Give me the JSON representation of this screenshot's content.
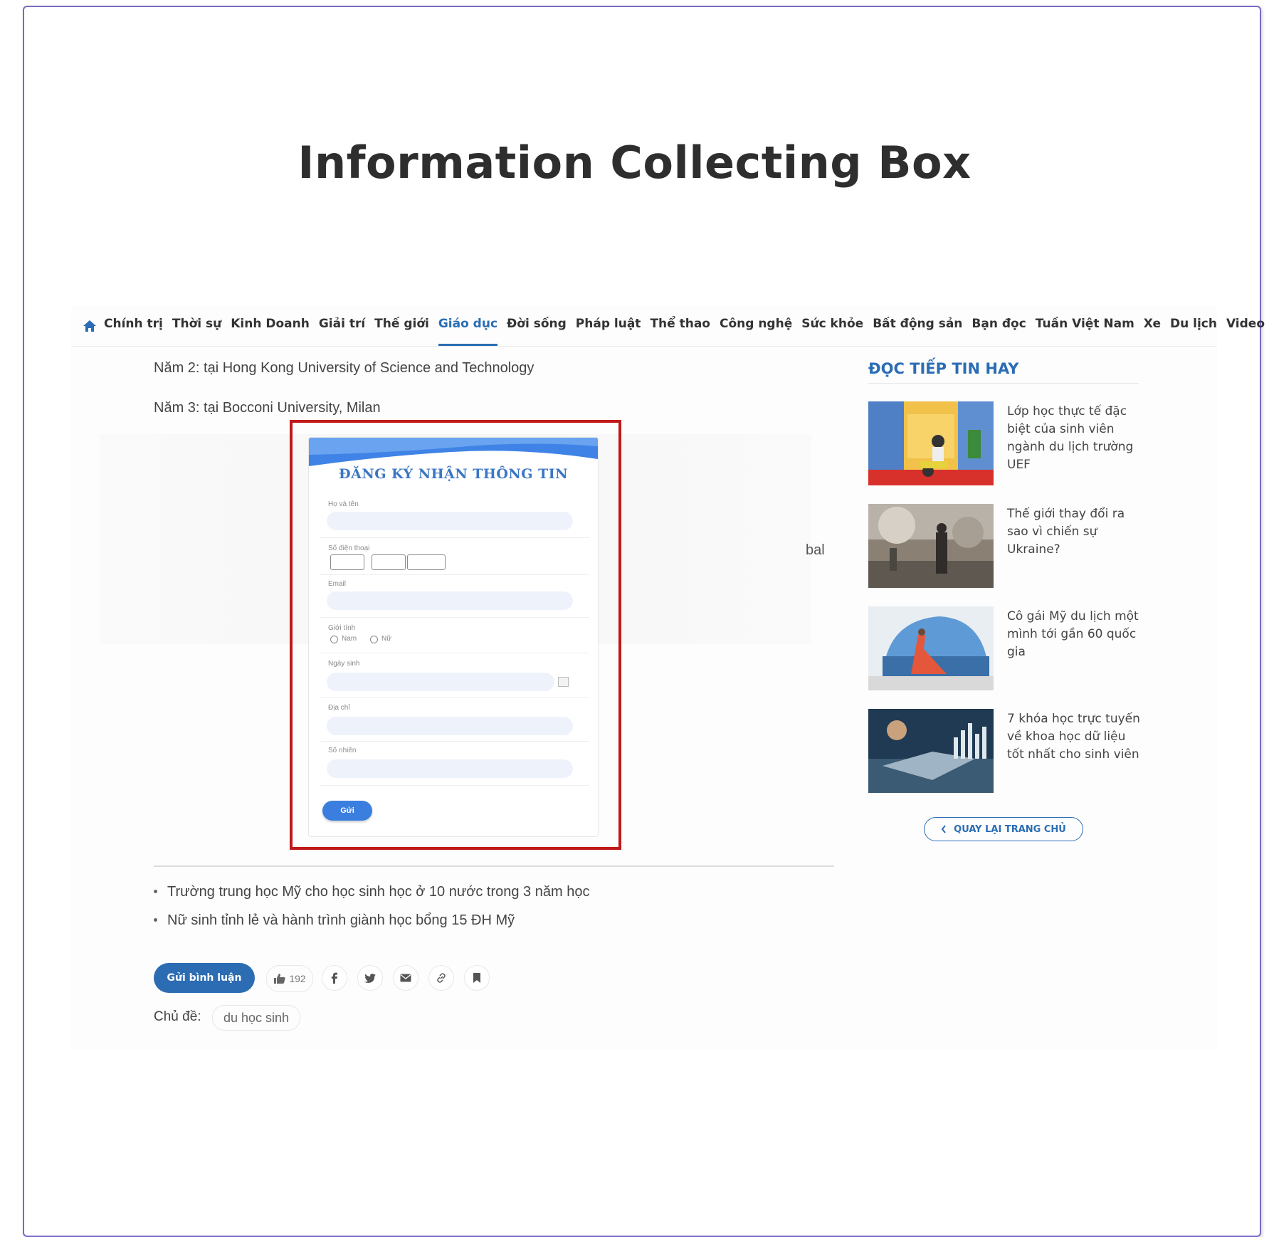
{
  "slide": {
    "title": "Information Collecting Box"
  },
  "nav": {
    "items": [
      "Chính trị",
      "Thời sự",
      "Kinh Doanh",
      "Giải trí",
      "Thế giới",
      "Giáo dục",
      "Đời sống",
      "Pháp luật",
      "Thể thao",
      "Công nghệ",
      "Sức khỏe",
      "Bất động sản",
      "Bạn đọc",
      "Tuần Việt Nam",
      "Xe",
      "Du lịch",
      "Video"
    ],
    "active": "Giáo dục",
    "accent": "#2a6db4"
  },
  "article": {
    "lines": [
      "Năm 2: tại Hong Kong University of Science and Technology",
      "Năm 3: tại Bocconi University, Milan"
    ],
    "cut_text": "bal",
    "related": [
      "Trường trung học Mỹ cho học sinh học ở 10 nước trong 3 năm học",
      "Nữ sinh tỉnh lẻ và hành trình giành học bổng 15 ĐH Mỹ"
    ]
  },
  "form": {
    "title": "ĐĂNG KÝ NHẬN THÔNG TIN",
    "fields": {
      "name": "Họ và tên",
      "phone": "Số điện thoại",
      "email": "Email",
      "gender": "Giới tính",
      "dob": "Ngày sinh",
      "address": "Địa chỉ",
      "school": "Số nhiên"
    },
    "gender_options": [
      "Nam",
      "Nữ"
    ],
    "submit": "Gửi",
    "highlight_color": "#c01919"
  },
  "actions": {
    "comment": "Gửi bình luận",
    "likes": "192",
    "icons": [
      "facebook-icon",
      "twitter-icon",
      "email-icon",
      "link-icon",
      "bookmark-icon"
    ]
  },
  "topic": {
    "label": "Chủ đề:",
    "tag": "du học sinh"
  },
  "sidebar": {
    "heading": "ĐỌC TIẾP TIN HAY",
    "items": [
      "Lớp học thực tế đặc biệt của sinh viên ngành du lịch trường UEF",
      "Thế giới thay đổi ra sao vì chiến sự Ukraine?",
      "Cô gái Mỹ du lịch một mình tới gần 60 quốc gia",
      "7 khóa học trực tuyến về khoa học dữ liệu tốt nhất cho sinh viên"
    ],
    "back_button": "QUAY LẠI TRANG CHỦ"
  }
}
